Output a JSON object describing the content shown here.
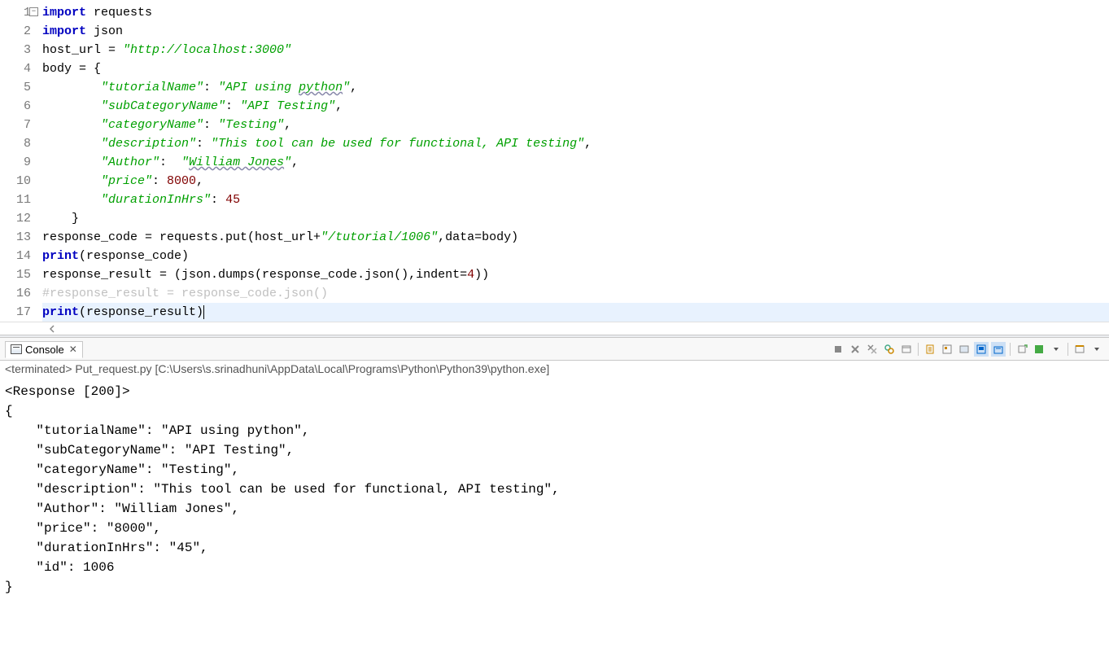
{
  "code": {
    "lines": [
      {
        "n": "1",
        "segs": [
          {
            "t": "import",
            "c": "kw"
          },
          {
            "t": " requests"
          }
        ]
      },
      {
        "n": "2",
        "segs": [
          {
            "t": "import",
            "c": "kw"
          },
          {
            "t": " json"
          }
        ]
      },
      {
        "n": "3",
        "segs": [
          {
            "t": "host_url = "
          },
          {
            "t": "\"http://localhost:3000\"",
            "c": "str"
          }
        ]
      },
      {
        "n": "4",
        "segs": [
          {
            "t": "body = {"
          }
        ]
      },
      {
        "n": "5",
        "segs": [
          {
            "t": "        "
          },
          {
            "t": "\"tutorialName\"",
            "c": "str"
          },
          {
            "t": ": "
          },
          {
            "t": "\"API using ",
            "c": "str"
          },
          {
            "t": "python",
            "c": "str underline"
          },
          {
            "t": "\"",
            "c": "str"
          },
          {
            "t": ","
          }
        ]
      },
      {
        "n": "6",
        "segs": [
          {
            "t": "        "
          },
          {
            "t": "\"subCategoryName\"",
            "c": "str"
          },
          {
            "t": ": "
          },
          {
            "t": "\"API Testing\"",
            "c": "str"
          },
          {
            "t": ","
          }
        ]
      },
      {
        "n": "7",
        "segs": [
          {
            "t": "        "
          },
          {
            "t": "\"categoryName\"",
            "c": "str"
          },
          {
            "t": ": "
          },
          {
            "t": "\"Testing\"",
            "c": "str"
          },
          {
            "t": ","
          }
        ]
      },
      {
        "n": "8",
        "segs": [
          {
            "t": "        "
          },
          {
            "t": "\"description\"",
            "c": "str"
          },
          {
            "t": ": "
          },
          {
            "t": "\"This tool can be used for functional, API testing\"",
            "c": "str"
          },
          {
            "t": ","
          }
        ]
      },
      {
        "n": "9",
        "segs": [
          {
            "t": "        "
          },
          {
            "t": "\"Author\"",
            "c": "str"
          },
          {
            "t": ":  "
          },
          {
            "t": "\"",
            "c": "str"
          },
          {
            "t": "William Jones",
            "c": "str underline"
          },
          {
            "t": "\"",
            "c": "str"
          },
          {
            "t": ","
          }
        ]
      },
      {
        "n": "10",
        "segs": [
          {
            "t": "        "
          },
          {
            "t": "\"price\"",
            "c": "str"
          },
          {
            "t": ": "
          },
          {
            "t": "8000",
            "c": "num"
          },
          {
            "t": ","
          }
        ]
      },
      {
        "n": "11",
        "segs": [
          {
            "t": "        "
          },
          {
            "t": "\"durationInHrs\"",
            "c": "str"
          },
          {
            "t": ": "
          },
          {
            "t": "45",
            "c": "num"
          }
        ]
      },
      {
        "n": "12",
        "segs": [
          {
            "t": "    }"
          }
        ]
      },
      {
        "n": "13",
        "segs": [
          {
            "t": "response_code = requests.put(host_url+"
          },
          {
            "t": "\"/tutorial/1006\"",
            "c": "str"
          },
          {
            "t": ",data=body)"
          }
        ]
      },
      {
        "n": "14",
        "segs": [
          {
            "t": "print",
            "c": "kw"
          },
          {
            "t": "(response_code)"
          }
        ]
      },
      {
        "n": "15",
        "segs": [
          {
            "t": "response_result = (json.dumps(response_code.json(),indent="
          },
          {
            "t": "4",
            "c": "num"
          },
          {
            "t": "))"
          }
        ]
      },
      {
        "n": "16",
        "segs": [
          {
            "t": "#response_result = response_code.json()",
            "c": "cmt"
          }
        ]
      },
      {
        "n": "17",
        "segs": [
          {
            "t": "print",
            "c": "kw"
          },
          {
            "t": "(response_result)"
          }
        ],
        "current": true,
        "cursor": true
      }
    ]
  },
  "console": {
    "tab_label": "Console",
    "path": "<terminated> Put_request.py [C:\\Users\\s.srinadhuni\\AppData\\Local\\Programs\\Python\\Python39\\python.exe]",
    "output": "<Response [200]>\n{\n    \"tutorialName\": \"API using python\",\n    \"subCategoryName\": \"API Testing\",\n    \"categoryName\": \"Testing\",\n    \"description\": \"This tool can be used for functional, API testing\",\n    \"Author\": \"William Jones\",\n    \"price\": \"8000\",\n    \"durationInHrs\": \"45\",\n    \"id\": 1006\n}"
  }
}
